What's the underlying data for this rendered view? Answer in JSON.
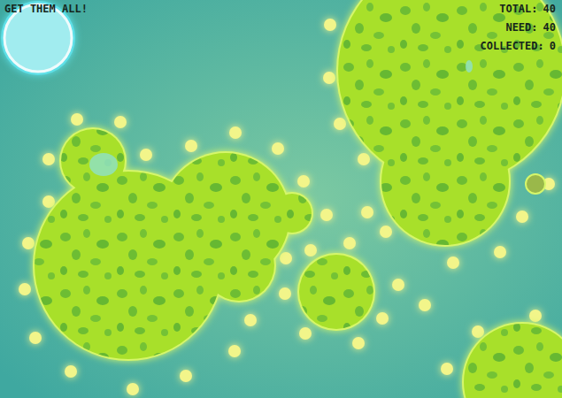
{
  "hud": {
    "objective": "GET THEM ALL!",
    "stats": [
      {
        "label": "TOTAL:",
        "value": "40"
      },
      {
        "label": "NEED:",
        "value": "40"
      },
      {
        "label": "COLLECTED:",
        "value": "0"
      }
    ]
  }
}
